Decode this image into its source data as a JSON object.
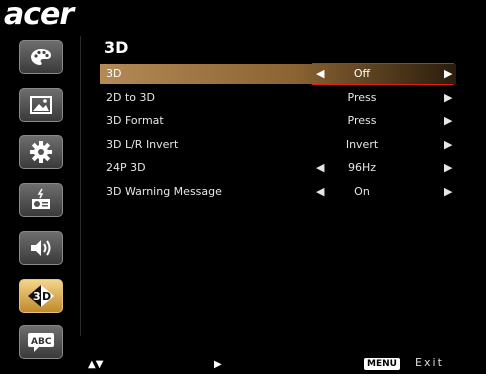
{
  "brand": {
    "logo": "acer"
  },
  "page": {
    "title": "3D"
  },
  "sidebar": {
    "items": [
      {
        "name": "color",
        "icon": "palette-icon",
        "active": false
      },
      {
        "name": "image",
        "icon": "image-icon",
        "active": false
      },
      {
        "name": "setting",
        "icon": "gear-icon",
        "active": false
      },
      {
        "name": "management",
        "icon": "projector-icon",
        "active": false
      },
      {
        "name": "audio",
        "icon": "speaker-icon",
        "active": false
      },
      {
        "name": "3d",
        "icon": "3d-icon",
        "active": true
      },
      {
        "name": "language",
        "icon": "abc-icon",
        "active": false
      }
    ]
  },
  "menu": {
    "rows": [
      {
        "label": "3D",
        "value": "Off",
        "left_arrow": true,
        "right_arrow": true,
        "selected": true
      },
      {
        "label": "2D to 3D",
        "value": "Press",
        "left_arrow": false,
        "right_arrow": true,
        "selected": false
      },
      {
        "label": "3D Format",
        "value": "Press",
        "left_arrow": false,
        "right_arrow": true,
        "selected": false
      },
      {
        "label": "3D L/R Invert",
        "value": "Invert",
        "left_arrow": false,
        "right_arrow": true,
        "selected": false
      },
      {
        "label": "24P 3D",
        "value": "96Hz",
        "left_arrow": true,
        "right_arrow": true,
        "selected": false
      },
      {
        "label": "3D Warning Message",
        "value": "On",
        "left_arrow": true,
        "right_arrow": true,
        "selected": false
      }
    ]
  },
  "footer": {
    "select_label": "Select",
    "enter_label": "Enter",
    "menu_badge": "MENU",
    "exit_label": "Exit"
  },
  "colors": {
    "accent": "#c08a2c",
    "highlight_border": "#e21b1b",
    "background": "#000000"
  }
}
